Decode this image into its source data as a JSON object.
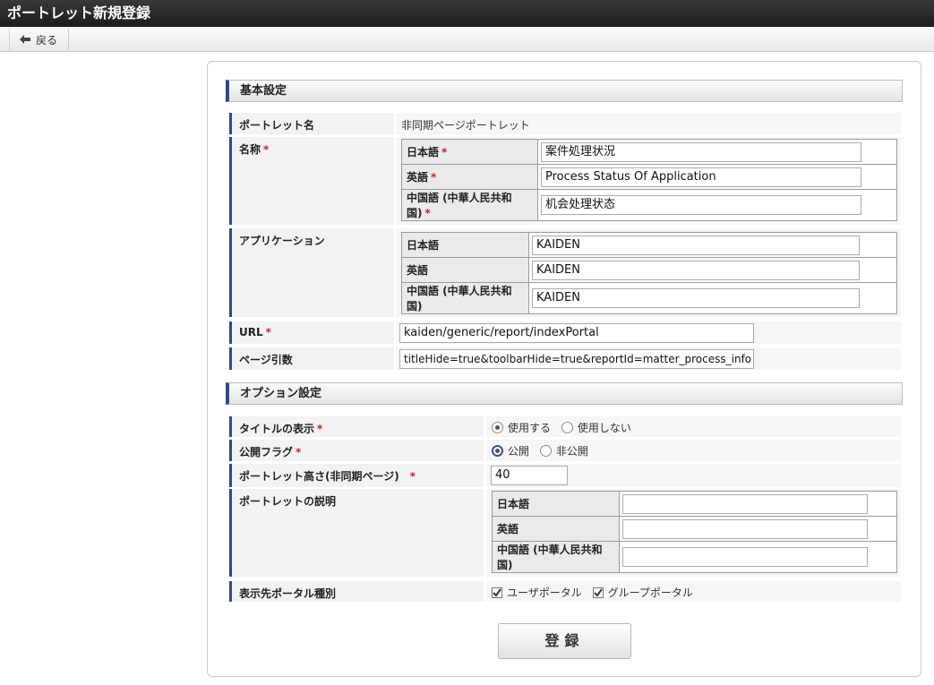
{
  "window": {
    "title": "ポートレット新規登録"
  },
  "toolbar": {
    "back_label": "戻る"
  },
  "basic": {
    "heading": "基本設定",
    "portlet_name": {
      "label": "ポートレット名",
      "value": "非同期ページポートレット"
    },
    "name": {
      "label": "名称",
      "langs": [
        {
          "label": "日本語",
          "value": "案件処理状況"
        },
        {
          "label": "英語",
          "value": "Process Status Of Application"
        },
        {
          "label": "中国語 (中華人民共和国)",
          "value": "机会处理状态"
        }
      ]
    },
    "application": {
      "label": "アプリケーション",
      "langs": [
        {
          "label": "日本語",
          "value": "KAIDEN"
        },
        {
          "label": "英語",
          "value": "KAIDEN"
        },
        {
          "label": "中国語 (中華人民共和国)",
          "value": "KAIDEN"
        }
      ]
    },
    "url": {
      "label": "URL",
      "value": "kaiden/generic/report/indexPortal"
    },
    "page_args": {
      "label": "ページ引数",
      "value": "titleHide=true&toolbarHide=true&reportId=matter_process_info"
    }
  },
  "options": {
    "heading": "オプション設定",
    "title_display": {
      "label": "タイトルの表示",
      "opt_on": "使用する",
      "opt_off": "使用しない",
      "selected": "使用する"
    },
    "public_flag": {
      "label": "公開フラグ",
      "opt_on": "公開",
      "opt_off": "非公開",
      "selected": "公開"
    },
    "height": {
      "label": "ポートレット高さ(非同期ページ)",
      "value": "40"
    },
    "description": {
      "label": "ポートレットの説明",
      "langs": [
        {
          "label": "日本語",
          "value": ""
        },
        {
          "label": "英語",
          "value": ""
        },
        {
          "label": "中国語 (中華人民共和国)",
          "value": ""
        }
      ]
    },
    "portal_type": {
      "label": "表示先ポータル種別",
      "user_portal": "ユーザポータル",
      "group_portal": "グループポータル",
      "user_checked": true,
      "group_checked": true
    }
  },
  "required_mark": "*",
  "submit_label": "登録",
  "colors": {
    "accent": "#2e4a8c",
    "required": "#d0211c",
    "titlebar": "#2b2b2b"
  }
}
